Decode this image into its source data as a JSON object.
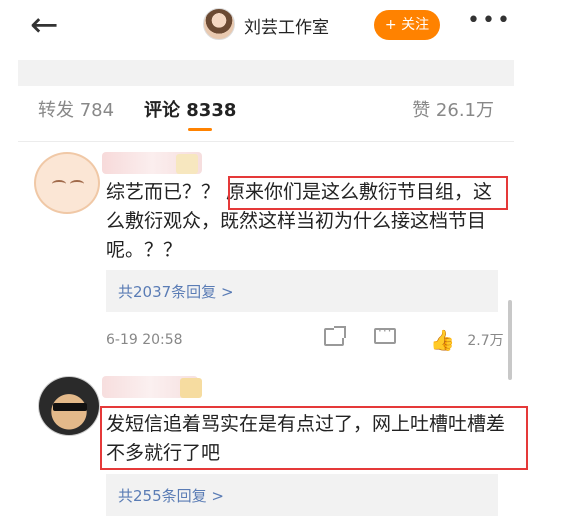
{
  "topbar": {
    "back_glyph": "←",
    "account_name": "刘芸工作室",
    "follow_label": "+ 关注",
    "more_glyph": "•••"
  },
  "tabs": {
    "repost": "转发 784",
    "comment": "评论 8338",
    "like": "赞 26.1万"
  },
  "comments": [
    {
      "text": "综艺而已？？ 原来你们是这么敷衍节目组，这么敷衍观众，既然这样当初为什么接这档节目呢。？？",
      "reply_link": "共2037条回复 >",
      "time": "6-19 20:58",
      "like_count": "2.7万"
    },
    {
      "text": "发短信追着骂实在是有点过了，网上吐槽吐槽差不多就行了吧",
      "reply_link": "共255条回复 >"
    }
  ],
  "colors": {
    "accent": "#ff8200",
    "link": "#5a7cb5",
    "highlight_box": "#e53939"
  },
  "icons": [
    "back-arrow-icon",
    "share-icon",
    "comment-icon",
    "like-icon",
    "more-icon"
  ]
}
